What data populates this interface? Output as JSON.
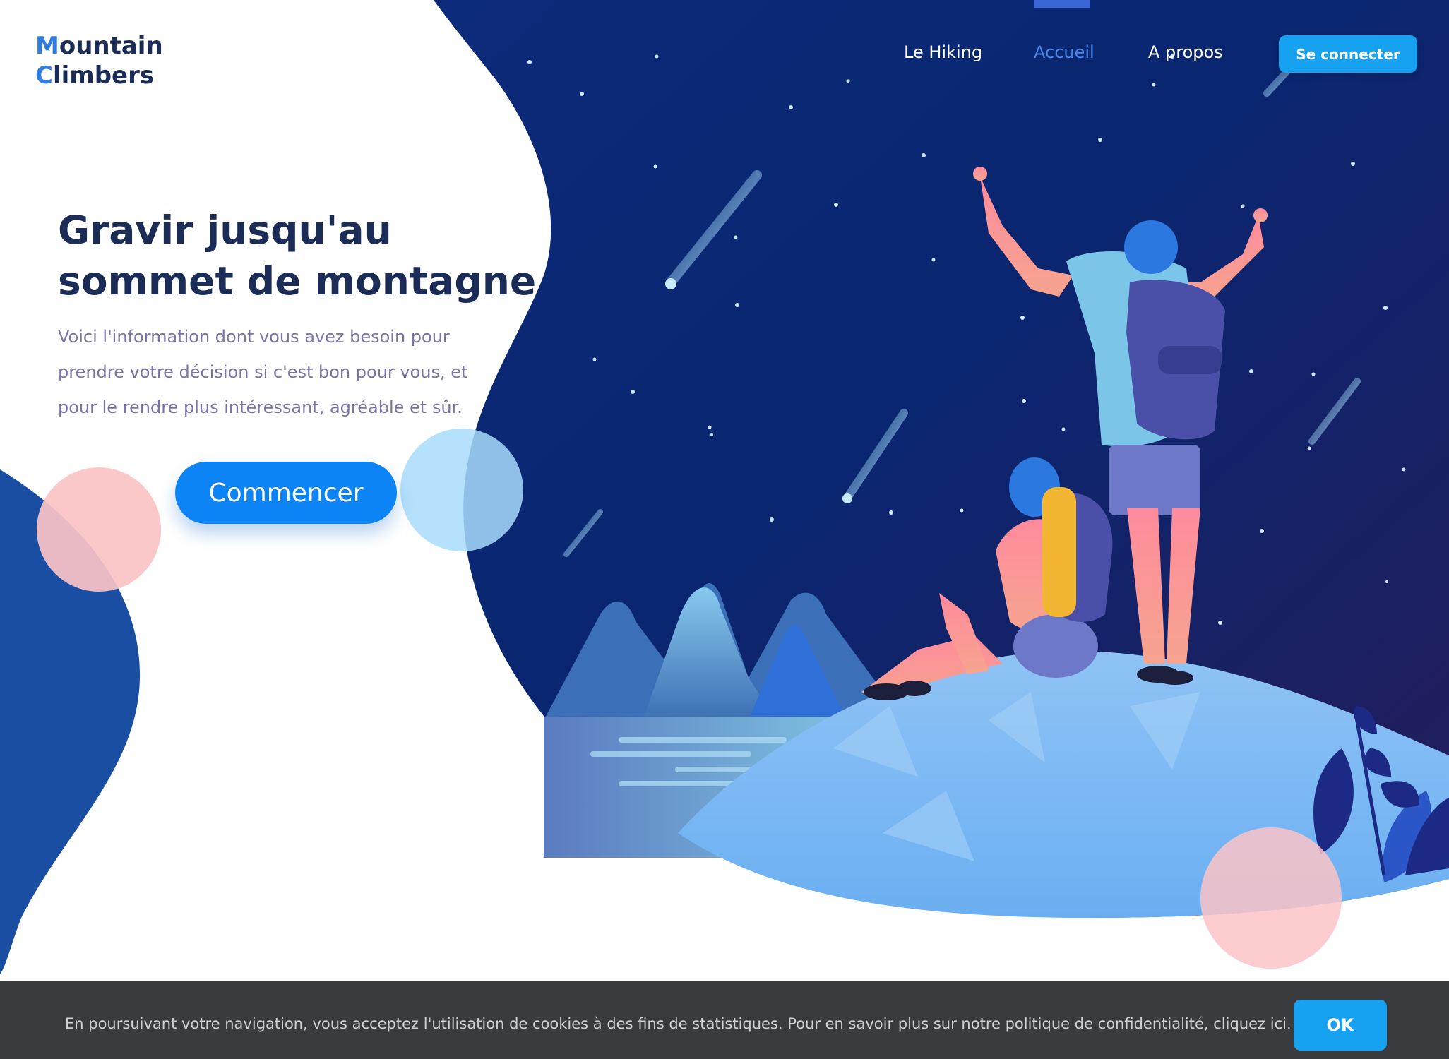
{
  "brand": {
    "logo_line1_initial": "M",
    "logo_line1_rest": "ountain",
    "logo_line2_initial": "C",
    "logo_line2_rest": "limbers"
  },
  "nav": {
    "items": [
      {
        "label": "Le Hiking"
      },
      {
        "label": "Accueil",
        "active": true
      },
      {
        "label": "A propos"
      }
    ],
    "login_label": "Se connecter"
  },
  "hero": {
    "title_line1": "Gravir jusqu'au",
    "title_line2": "sommet de montagne",
    "description": "Voici l'information dont vous avez besoin pour prendre votre décision si c'est bon pour vous, et pour le rendre plus intéressant, agréable et sûr.",
    "cta_label": "Commencer"
  },
  "cookie": {
    "text": "En poursuivant votre navigation, vous acceptez l'utilisation de cookies à des fins de statistiques. Pour en savoir plus sur notre politique de confidentialité, cliquez ici.",
    "ok_label": "OK"
  },
  "colors": {
    "brand_dark": "#1b2d57",
    "accent": "#2f7de1",
    "primary_button": "#0d84f5",
    "secondary_button": "#16a2f1",
    "cookie_bg": "#3a3b3e"
  }
}
